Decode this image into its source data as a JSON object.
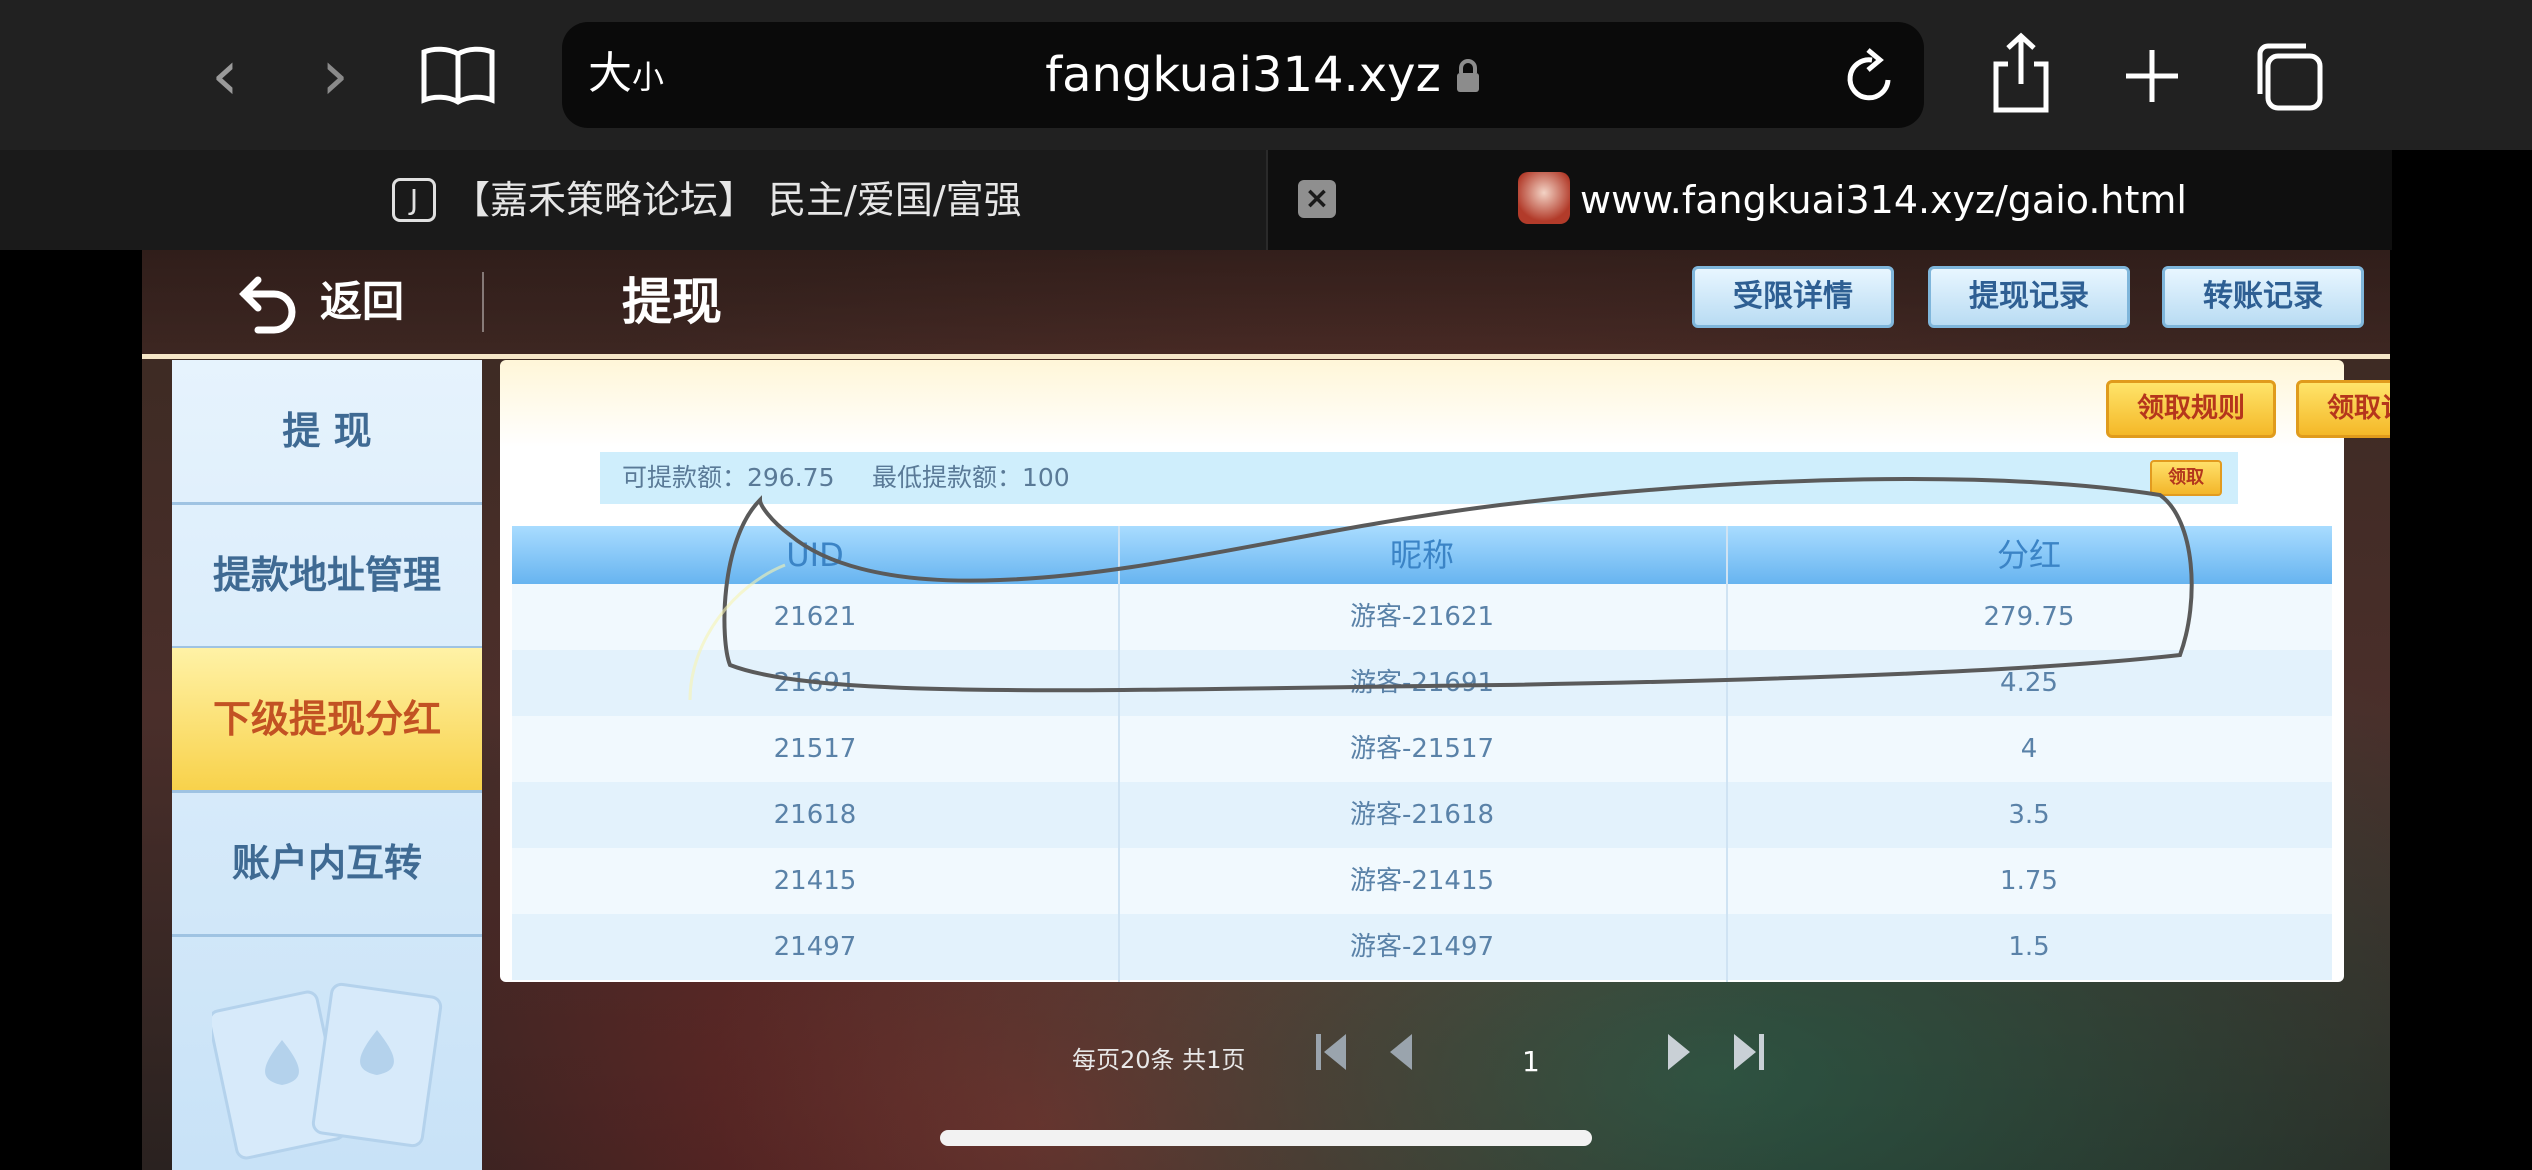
{
  "browser": {
    "reader_large": "大",
    "reader_small": "小",
    "url": "fangkuai314.xyz",
    "tabs": [
      {
        "icon_letter": "J",
        "title": "【嘉禾策略论坛】 民主/爱国/富强"
      },
      {
        "title": "www.fangkuai314.xyz/gaio.html"
      }
    ]
  },
  "header": {
    "back_label": "返回",
    "title": "提现",
    "buttons": [
      "受限详情",
      "提现记录",
      "转账记录"
    ]
  },
  "sidebar": {
    "items": [
      {
        "label": "提 现",
        "active": false
      },
      {
        "label": "提款地址管理",
        "active": false
      },
      {
        "label": "下级提现分红",
        "active": true
      },
      {
        "label": "账户内互转",
        "active": false
      }
    ]
  },
  "panel": {
    "rule_button": "领取规则",
    "record_button": "领取记录",
    "available_label": "可提款额：296.75",
    "min_label": "最低提款额：100",
    "claim_button": "领取"
  },
  "table": {
    "columns": [
      "UID",
      "昵称",
      "分红"
    ],
    "rows": [
      [
        "21621",
        "游客-21621",
        "279.75"
      ],
      [
        "21691",
        "游客-21691",
        "4.25"
      ],
      [
        "21517",
        "游客-21517",
        "4"
      ],
      [
        "21618",
        "游客-21618",
        "3.5"
      ],
      [
        "21415",
        "游客-21415",
        "1.75"
      ],
      [
        "21497",
        "游客-21497",
        "1.5"
      ]
    ]
  },
  "pager": {
    "summary": "每页20条 共1页",
    "current_page": "1"
  },
  "colors": {
    "active_tab_bg": "#f8d24b",
    "header_button_text": "#2e5f93",
    "gold_button_text": "#b5361c"
  }
}
